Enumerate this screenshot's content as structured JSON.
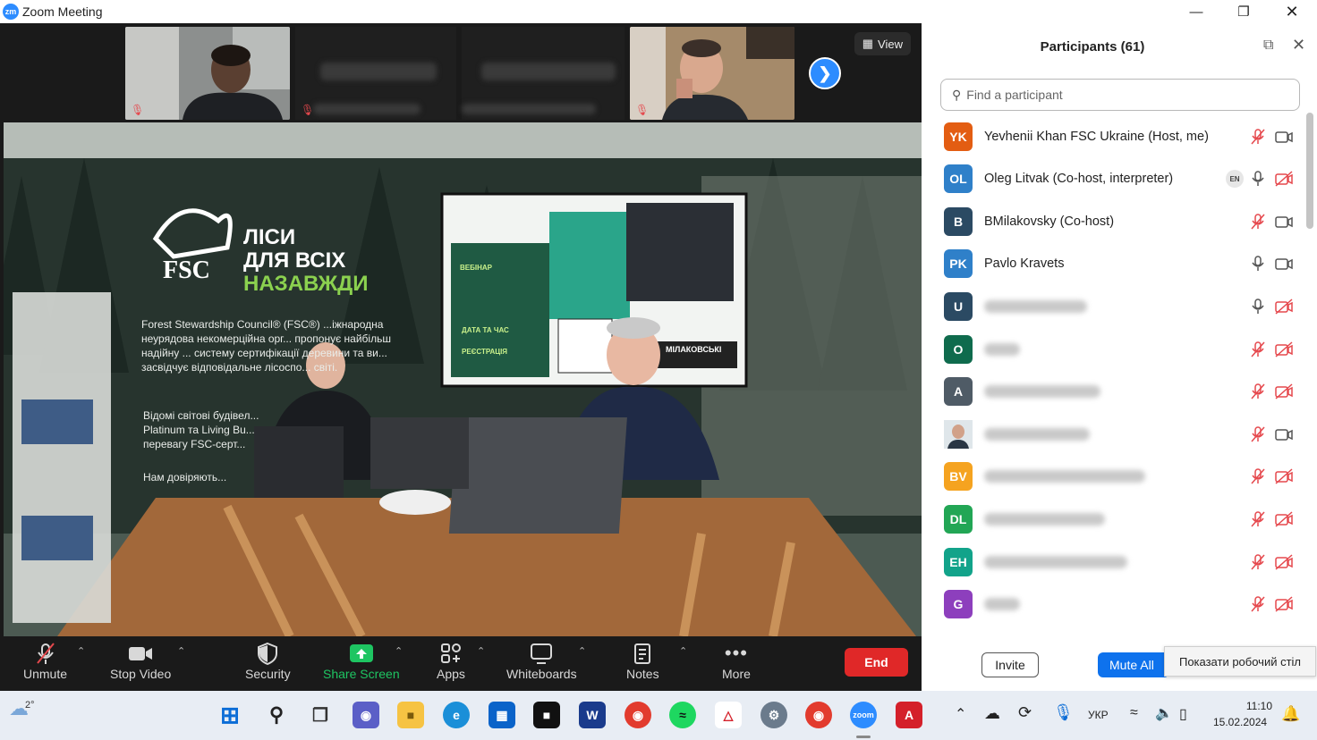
{
  "window": {
    "logo": "zm",
    "title": "Zoom Meeting",
    "controls": [
      "minimize-icon",
      "maximize-icon",
      "close-icon"
    ]
  },
  "gallery": {
    "view_label": "View"
  },
  "toolbar": {
    "items": [
      {
        "label": "Unmute",
        "icon": "mic-off-icon"
      },
      {
        "label": "Stop Video",
        "icon": "video-camera-icon"
      },
      {
        "label": "Security",
        "icon": "shield-icon"
      },
      {
        "label": "Share Screen",
        "icon": "share-screen-icon"
      },
      {
        "label": "Apps",
        "icon": "apps-icon"
      },
      {
        "label": "Whiteboards",
        "icon": "whiteboard-icon"
      },
      {
        "label": "Notes",
        "icon": "notes-icon"
      },
      {
        "label": "More",
        "icon": "more-icon"
      }
    ],
    "end_label": "End",
    "share_color": "#1ec562",
    "end_color": "#e02828"
  },
  "participants": {
    "title": "Participants (61)",
    "search_placeholder": "Find a participant",
    "list": [
      {
        "initials": "YK",
        "name": "Yevhenii Khan FSC Ukraine (Host, me)",
        "color": "#e35d12",
        "mic": "muted",
        "cam": "on"
      },
      {
        "initials": "OL",
        "name": "Oleg Litvak (Co-host, interpreter)",
        "color": "#2f80c9",
        "mic": "on",
        "cam": "off",
        "lang": "EN"
      },
      {
        "initials": "B",
        "name": "BMilakovsky (Co-host)",
        "color": "#2b4a63",
        "mic": "muted",
        "cam": "on"
      },
      {
        "initials": "PK",
        "name": "Pavlo Kravets",
        "color": "#2f80c9",
        "mic": "on",
        "cam": "on"
      },
      {
        "initials": "U",
        "name": "",
        "color": "#2b4a63",
        "mic": "on",
        "cam": "off"
      },
      {
        "initials": "O",
        "name": "",
        "color": "#0f6b4d",
        "mic": "muted",
        "cam": "off"
      },
      {
        "initials": "A",
        "name": "",
        "color": "#4f5b66",
        "mic": "muted",
        "cam": "off"
      },
      {
        "initials": "",
        "name": "",
        "color": "#cfd8de",
        "mic": "muted",
        "cam": "on",
        "photo": true
      },
      {
        "initials": "BV",
        "name": "",
        "color": "#f5a320",
        "mic": "muted",
        "cam": "off"
      },
      {
        "initials": "DL",
        "name": "",
        "color": "#22a655",
        "mic": "muted",
        "cam": "off"
      },
      {
        "initials": "EH",
        "name": "",
        "color": "#12a38a",
        "mic": "muted",
        "cam": "off"
      },
      {
        "initials": "G",
        "name": "",
        "color": "#8d3fbd",
        "mic": "muted",
        "cam": "off"
      }
    ],
    "invite_label": "Invite",
    "mute_all_label": "Mute All",
    "tooltip": "Показати робочий стіл"
  },
  "stage": {
    "banner_brand": "FSC",
    "banner_title_1": "ЛІСИ",
    "banner_title_2": "ДЛЯ ВСІХ",
    "banner_title_3": "НАЗАВЖДИ",
    "banner_paragraph": "Forest Stewardship Council® (FSC®) ...іжнародна неурядова некомерційна орг... пропонує найбільш надійну ... систему сертифікації деревини та ви... засвідчує відповідальне лісоспо... світі.",
    "banner_line_2": "Відомі світові будівел... Platinum та Living Bu... перевагу FSC-серт...",
    "banner_line_3": "Нам довіряють...",
    "screen_label_1": "ВЕБІНАР",
    "screen_label_2": "ДАТА ТА ЧАС",
    "screen_label_3": "РЕЄСТРАЦІЯ",
    "screen_name": "МІЛАКОВСЬКІ"
  },
  "taskbar": {
    "weather": "2°",
    "lang": "УКР",
    "time": "11:10",
    "date": "15.02.2024"
  }
}
